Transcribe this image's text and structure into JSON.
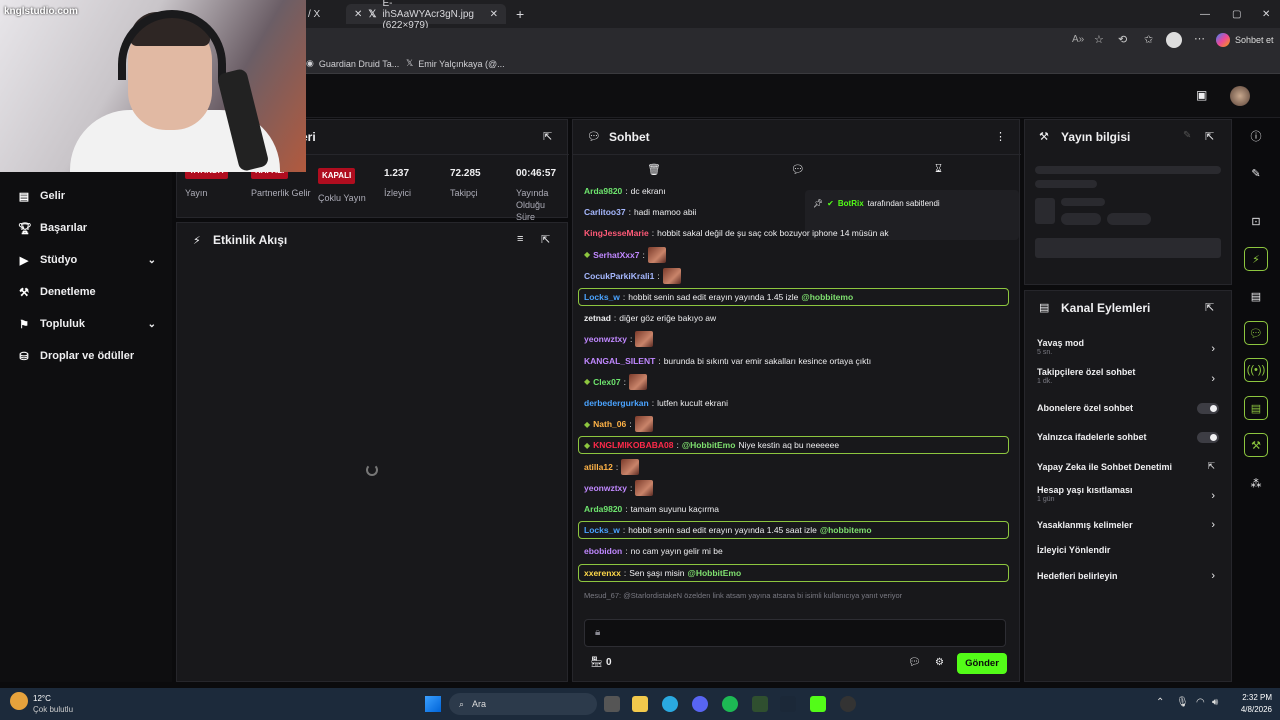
{
  "browser": {
    "tabs": [
      {
        "label": "/ X"
      },
      {
        "label": "E-ihSAaWYAcr3gN.jpg (622×979)"
      }
    ],
    "new_tab": "+",
    "copilot_label": "Sohbet et",
    "bookmarks": [
      {
        "label": "Guardian Druid Ta..."
      },
      {
        "label": "Emir Yalçınkaya (@..."
      }
    ]
  },
  "webcam": {
    "watermark": "knglstudio.com"
  },
  "sidebar": {
    "items": [
      {
        "label": "Gelir",
        "icon": "money-icon"
      },
      {
        "label": "Başarılar",
        "icon": "trophy-icon"
      },
      {
        "label": "Stüdyo",
        "icon": "camera-icon",
        "expandable": true
      },
      {
        "label": "Denetleme",
        "icon": "wrench-icon"
      },
      {
        "label": "Topluluk",
        "icon": "people-icon",
        "expandable": true
      },
      {
        "label": "Droplar ve ödüller",
        "icon": "gift-icon"
      }
    ]
  },
  "stream_panel": {
    "title_fragment": "eri",
    "stats": [
      {
        "badge": "YAYINDA",
        "label": "Yayın"
      },
      {
        "badge": "KAPALI",
        "label": "Partnerlik Gelir"
      },
      {
        "badge": "KAPALI",
        "label": "Çoklu Yayın"
      },
      {
        "value": "1.237",
        "label": "İzleyici"
      },
      {
        "value": "72.285",
        "label": "Takipçi"
      },
      {
        "value": "00:46:57",
        "label": "Yayında Olduğu Süre"
      }
    ]
  },
  "activity": {
    "title": "Etkinlik Akışı"
  },
  "chat": {
    "title": "Sohbet",
    "pinned": {
      "user": "BotRix",
      "text": "tarafından sabitlendi"
    },
    "messages": [
      {
        "user": "Arda9820",
        "color": "#6ee56e",
        "text": "dc ekranı"
      },
      {
        "user": "Carlitoo37",
        "color": "#a6b8ff",
        "text": "hadi mamoo abii"
      },
      {
        "user": "KingJesseMarie",
        "color": "#ff5a78",
        "text": "hobbit sakal değil de şu saç cok bozuyor iphone 14 müsün ak"
      },
      {
        "user": "SerhatXxx7",
        "color": "#c088ff",
        "text": "",
        "emote": true,
        "badge": true
      },
      {
        "user": "CocukParkiKrali1",
        "color": "#a6b8ff",
        "text": "",
        "emote": true
      },
      {
        "user": "Locks_w",
        "color": "#4aa3ff",
        "text": "hobbit senin sad edit erayın yayında 1.45 izle",
        "mention": "@hobbitemo",
        "highlight": true
      },
      {
        "user": "zetnad",
        "color": "#efeff1",
        "text": "diğer göz eriğe bakıyo aw"
      },
      {
        "user": "yeonwztxy",
        "color": "#c088ff",
        "text": "",
        "emote": true
      },
      {
        "user": "KANGAL_SILENT",
        "color": "#c088ff",
        "text": "burunda bi sıkıntı var emir sakalları kesince ortaya çıktı"
      },
      {
        "user": "Clex07",
        "color": "#6ee56e",
        "text": "",
        "emote": true,
        "badge": true
      },
      {
        "user": "derbedergurkan",
        "color": "#4aa3ff",
        "text": "lutfen kucult ekrani"
      },
      {
        "user": "Nath_06",
        "color": "#ffb347",
        "text": "",
        "emote": true,
        "badge": true
      },
      {
        "user": "KNGLMIKOBABA08",
        "color": "#ff2a4a",
        "text": "Niye kestin aq bu neeeeee",
        "mention": "@HobbitEmo",
        "highlight": true,
        "badge": true,
        "mention_first": true
      },
      {
        "user": "atilla12",
        "color": "#ffb347",
        "text": "",
        "emote": true
      },
      {
        "user": "yeonwztxy",
        "color": "#c088ff",
        "text": "",
        "emote": true
      },
      {
        "user": "Arda9820",
        "color": "#6ee56e",
        "text": "tamam suyunu kaçırma"
      },
      {
        "user": "Locks_w",
        "color": "#4aa3ff",
        "text": "hobbit senin sad edit erayın yayında 1.45 saat izle",
        "mention": "@hobbitemo",
        "highlight": true
      },
      {
        "user": "ebobidon",
        "color": "#c088ff",
        "text": "no cam yayın gelir mi be"
      },
      {
        "user": "xxerenxx",
        "color": "#ffd94a",
        "text": "Sen şaşı misin",
        "mention": "@HobbitEmo",
        "highlight": true
      }
    ],
    "reply_preview": "Mesud_67: @StarlordistakeN özelden link atsam yayına atsana bi isimli kullanıcıya yanıt veriyor",
    "input_placeholder": "",
    "points": "0",
    "send_label": "Gönder"
  },
  "info_panel": {
    "title": "Yayın bilgisi"
  },
  "channel_actions": {
    "title": "Kanal Eylemleri",
    "items": [
      {
        "label": "Yavaş mod",
        "sub": "5 sn.",
        "control": "chevron"
      },
      {
        "label": "Takipçilere özel sohbet",
        "sub": "1 dk.",
        "control": "chevron"
      },
      {
        "label": "Abonelere özel sohbet",
        "sub": "",
        "control": "toggle"
      },
      {
        "label": "Yalnızca ifadelerle sohbet",
        "sub": "",
        "control": "toggle"
      },
      {
        "label": "Yapay Zeka ile Sohbet Denetimi",
        "sub": "",
        "control": "external"
      },
      {
        "label": "Hesap yaşı kısıtlaması",
        "sub": "1 gün",
        "control": "chevron"
      },
      {
        "label": "Yasaklanmış kelimeler",
        "sub": "",
        "control": "chevron"
      },
      {
        "label": "İzleyici Yönlendir",
        "sub": "",
        "control": "none"
      },
      {
        "label": "Hedefleri belirleyin",
        "sub": "",
        "control": "chevron"
      }
    ]
  },
  "taskbar": {
    "weather_temp": "12°C",
    "weather_desc": "Çok bulutlu",
    "search_label": "Ara",
    "time": "2:32 PM",
    "date": "4/8/2026"
  },
  "colors": {
    "accent": "#53fc18",
    "highlight_border": "#8dc63f",
    "live_badge": "#b00d1f",
    "panel": "#18181b"
  }
}
